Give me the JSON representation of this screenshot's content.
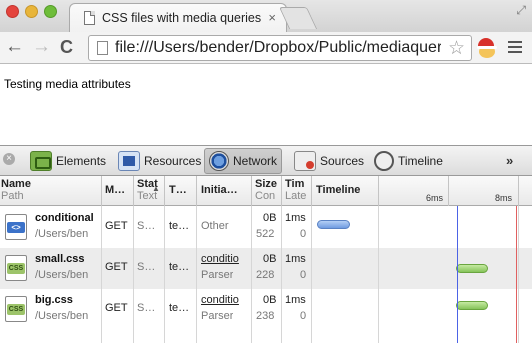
{
  "browser": {
    "tab_title": "CSS files with media queries",
    "tab_close": "×",
    "url": "file:///Users/bender/Dropbox/Public/mediaquer…",
    "back_glyph": "←",
    "forward_glyph": "→",
    "reload_glyph": "C",
    "star_glyph": "☆",
    "resize_glyph": "⤢"
  },
  "page": {
    "text": "Testing media attributes"
  },
  "devtools": {
    "tabs": [
      {
        "label": "Elements",
        "icon": "elements-icon"
      },
      {
        "label": "Resources",
        "icon": "resources-icon"
      },
      {
        "label": "Network",
        "icon": "network-icon",
        "active": true
      },
      {
        "label": "Sources",
        "icon": "sources-icon"
      },
      {
        "label": "Timeline",
        "icon": "timeline-icon"
      }
    ],
    "more_glyph": "»",
    "close_glyph": "×",
    "columns": {
      "name": "Name",
      "path": "Path",
      "method": "M…",
      "status": "Stat",
      "status_sub": "Text",
      "type": "T…",
      "initiator": "Initia…",
      "size": "Size",
      "size_sub": "Con",
      "time": "Tim",
      "time_sub": "Late",
      "timeline": "Timeline",
      "tick_1": "6ms",
      "tick_2": "8ms"
    },
    "rows": [
      {
        "name": "conditional",
        "path": "/Users/ben",
        "method": "GET",
        "status": "S…",
        "type": "te…",
        "initiator": "Other",
        "initiator_sub": "",
        "size": "0B",
        "size_sub": "522",
        "time": "1ms",
        "time_sub": "0",
        "icon": "html-file-icon"
      },
      {
        "name": "small.css",
        "path": "/Users/ben",
        "method": "GET",
        "status": "S…",
        "type": "te…",
        "initiator": "conditio",
        "initiator_sub": "Parser",
        "size": "0B",
        "size_sub": "228",
        "time": "1ms",
        "time_sub": "0",
        "icon": "css-file-icon"
      },
      {
        "name": "big.css",
        "path": "/Users/ben",
        "method": "GET",
        "status": "S…",
        "type": "te…",
        "initiator": "conditio",
        "initiator_sub": "Parser",
        "size": "0B",
        "size_sub": "238",
        "time": "1ms",
        "time_sub": "0",
        "icon": "css-file-icon"
      }
    ],
    "file_badges": {
      "html": "<>",
      "css": "CSS"
    }
  },
  "colors": {
    "blue_bar": "#6f9be0",
    "green_bar": "#86c45a",
    "dom_content_line": "#4c63e6",
    "load_line": "#e06060"
  }
}
